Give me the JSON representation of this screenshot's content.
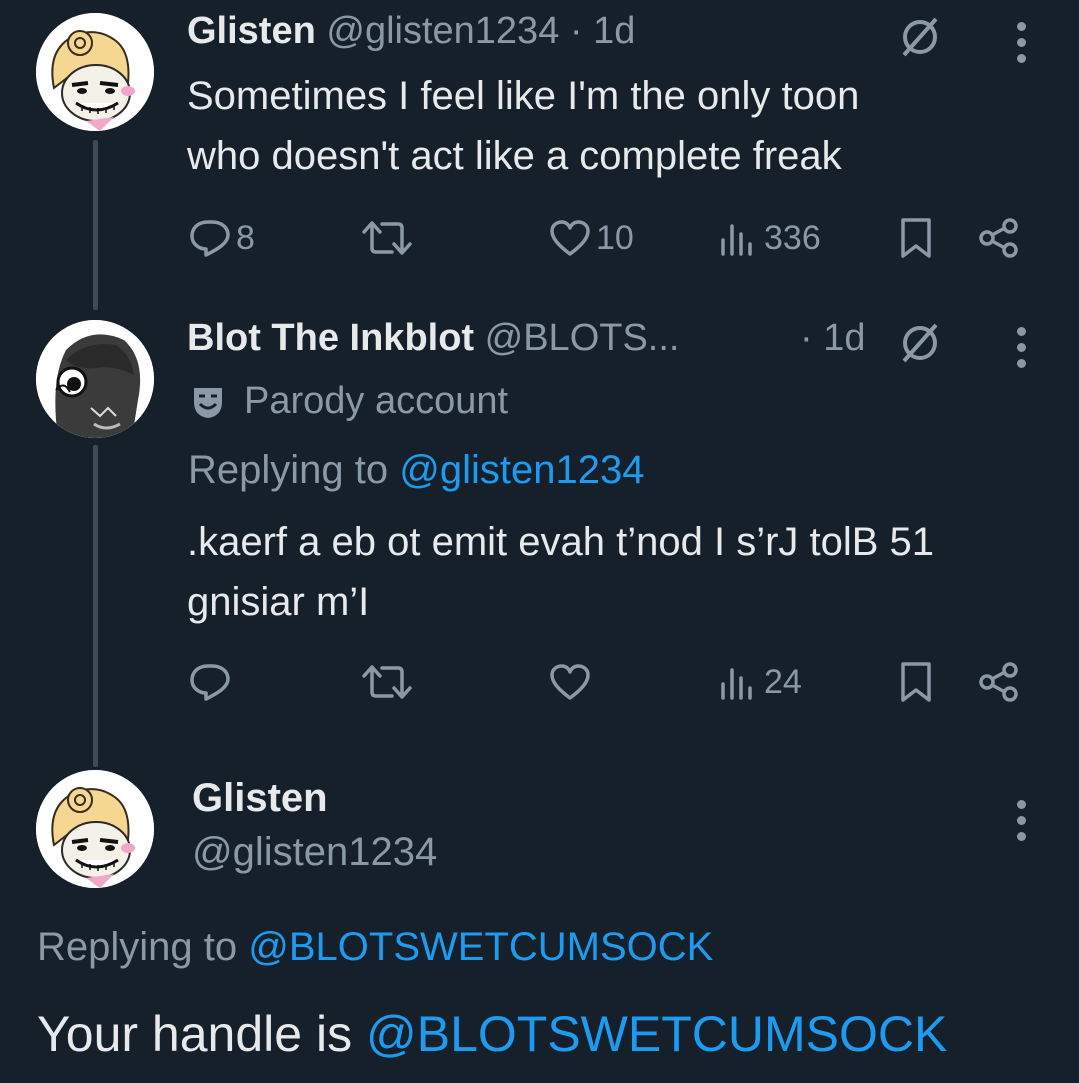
{
  "tweet1": {
    "display_name": "Glisten",
    "handle": "@glisten1234",
    "separator": "·",
    "time": "1d",
    "text_line1": "Sometimes I feel like I'm the only toon",
    "text_line2": "who doesn't act like a complete freak",
    "replies": "8",
    "likes": "10",
    "views": "336"
  },
  "tweet2": {
    "display_name": "Blot The Inkblot",
    "handle": "@BLOTS...",
    "separator": "·",
    "time": "1d",
    "parody_label": "Parody account",
    "replying_prefix": "Replying to",
    "replying_handle": "@glisten1234",
    "text_line1": ".kaerf a eb ot emit evah t’nod I s’rJ tolB 51",
    "text_line2": "gnisiar m’I",
    "views": "24"
  },
  "tweet3": {
    "display_name": "Glisten",
    "handle": "@glisten1234",
    "replying_prefix": "Replying to",
    "replying_handle": "@BLOTSWETCUMSOCK",
    "text_prefix": "Your handle is",
    "text_mention": "@BLOTSWETCUMSOCK"
  },
  "colors": {
    "background": "#15202b",
    "text": "#e7e9ea",
    "muted": "#8b98a5",
    "accent": "#1d9bf0"
  },
  "icons": [
    "reply-icon",
    "retweet-icon",
    "like-icon",
    "views-icon",
    "bookmark-icon",
    "share-icon",
    "grok-icon",
    "more-icon",
    "parody-mask-icon"
  ]
}
